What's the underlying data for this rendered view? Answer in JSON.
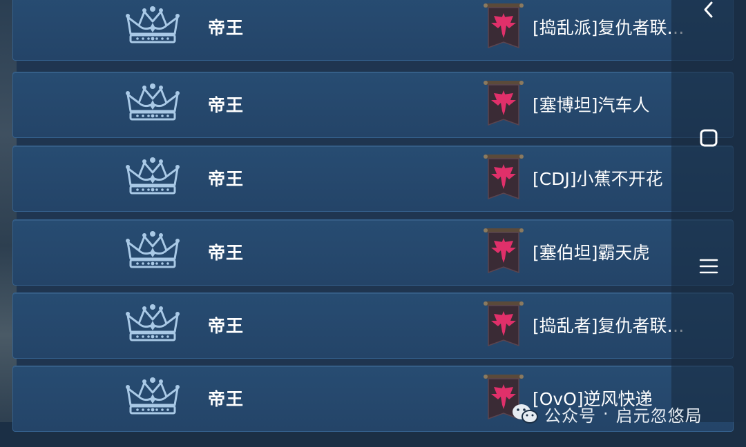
{
  "rows": [
    {
      "rank": "帝王",
      "clan": "[捣乱派]复仇者联…"
    },
    {
      "rank": "帝王",
      "clan": "[塞博坦]汽车人"
    },
    {
      "rank": "帝王",
      "clan": "[CDJ]小蕉不开花"
    },
    {
      "rank": "帝王",
      "clan": "[塞伯坦]霸天虎"
    },
    {
      "rank": "帝王",
      "clan": "[捣乱者]复仇者联…"
    },
    {
      "rank": "帝王",
      "clan": "[OvO]逆风快递"
    }
  ],
  "icons": {
    "rank_icon": "crown-icon",
    "clan_icon": "phoenix-banner-icon",
    "nav": [
      "back-icon",
      "home-square-icon",
      "menu-icon"
    ],
    "watermark": "wechat-icon"
  },
  "watermark": {
    "prefix": "公众号",
    "separator": "·",
    "account": "启元忽悠局"
  },
  "colors": {
    "row_bg": "#264a70",
    "row_border": "#35618d",
    "crown": "#a9c9e6",
    "banner_bg": "#3a2b35",
    "phoenix": "#e0306a"
  }
}
